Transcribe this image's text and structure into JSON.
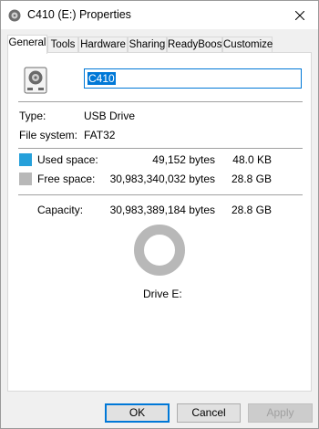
{
  "window": {
    "title": "C410 (E:) Properties"
  },
  "tabs": [
    {
      "label": "General"
    },
    {
      "label": "Tools"
    },
    {
      "label": "Hardware"
    },
    {
      "label": "Sharing"
    },
    {
      "label": "ReadyBoost"
    },
    {
      "label": "Customize"
    }
  ],
  "general": {
    "volume_name": "C410",
    "type_label": "Type:",
    "type_value": "USB Drive",
    "fs_label": "File system:",
    "fs_value": "FAT32",
    "used": {
      "label": "Used space:",
      "bytes": "49,152 bytes",
      "size": "48.0 KB",
      "color": "#26a0da"
    },
    "free": {
      "label": "Free space:",
      "bytes": "30,983,340,032 bytes",
      "size": "28.8 GB",
      "color": "#b8b8b8"
    },
    "capacity": {
      "label": "Capacity:",
      "bytes": "30,983,389,184 bytes",
      "size": "28.8 GB"
    },
    "drive_label": "Drive E:"
  },
  "buttons": {
    "ok": "OK",
    "cancel": "Cancel",
    "apply": "Apply"
  },
  "icons": {
    "title": "drive-icon",
    "close": "close-icon",
    "drive": "drive-icon"
  }
}
